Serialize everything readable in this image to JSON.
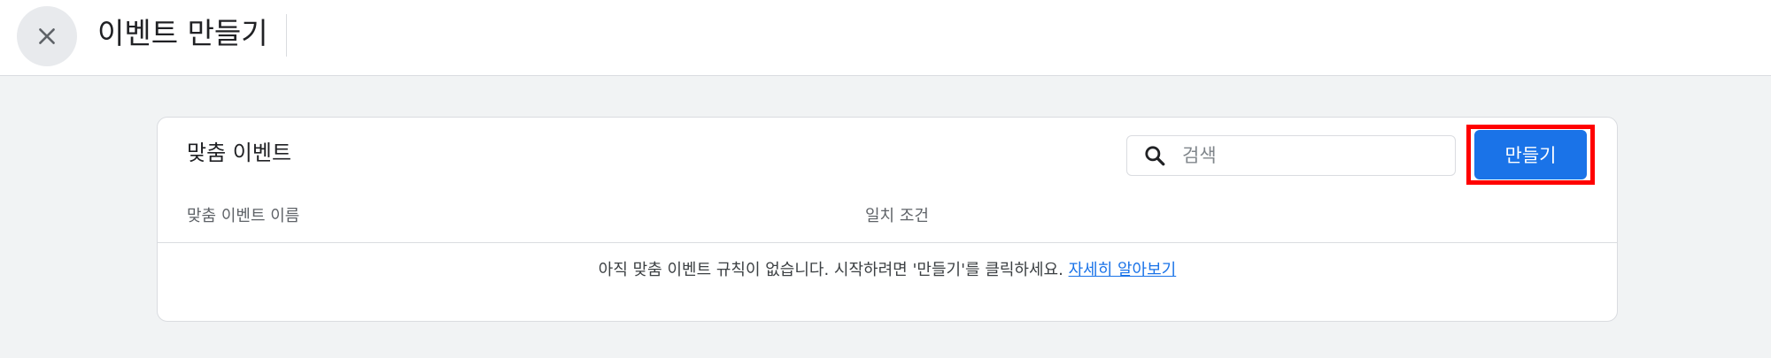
{
  "header": {
    "title": "이벤트 만들기",
    "close_icon": "close-icon"
  },
  "custom_events": {
    "title": "맞춤 이벤트",
    "search": {
      "placeholder": "검색",
      "value": ""
    },
    "create_label": "만들기",
    "columns": [
      "맞춤 이벤트 이름",
      "일치 조건"
    ],
    "empty_message": "아직 맞춤 이벤트 규칙이 없습니다. 시작하려면 '만들기'를 클릭하세요.",
    "learn_more": "자세히 알아보기"
  },
  "colors": {
    "accent": "#1a73e8",
    "highlight": "#ff0000",
    "background": "#f1f3f4"
  }
}
